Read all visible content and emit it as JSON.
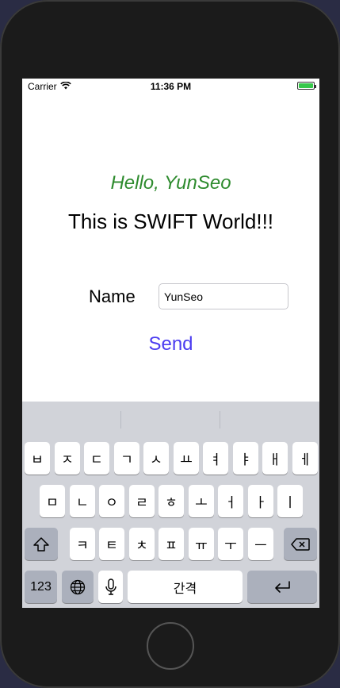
{
  "status_bar": {
    "carrier": "Carrier",
    "time": "11:36 PM"
  },
  "content": {
    "greeting": "Hello,  YunSeo",
    "headline": "This is SWIFT World!!!",
    "name_label": "Name",
    "name_value": "YunSeo",
    "send_label": "Send"
  },
  "keyboard": {
    "row1": [
      "ㅂ",
      "ㅈ",
      "ㄷ",
      "ㄱ",
      "ㅅ",
      "ㅛ",
      "ㅕ",
      "ㅑ",
      "ㅐ",
      "ㅔ"
    ],
    "row2": [
      "ㅁ",
      "ㄴ",
      "ㅇ",
      "ㄹ",
      "ㅎ",
      "ㅗ",
      "ㅓ",
      "ㅏ",
      "ㅣ"
    ],
    "row3": [
      "ㅋ",
      "ㅌ",
      "ㅊ",
      "ㅍ",
      "ㅠ",
      "ㅜ",
      "ㅡ"
    ],
    "numbers_label": "123",
    "space_label": "간격"
  },
  "colors": {
    "greeting": "#2e8b2e",
    "send": "#4b3cf0",
    "battery": "#37c84a"
  }
}
